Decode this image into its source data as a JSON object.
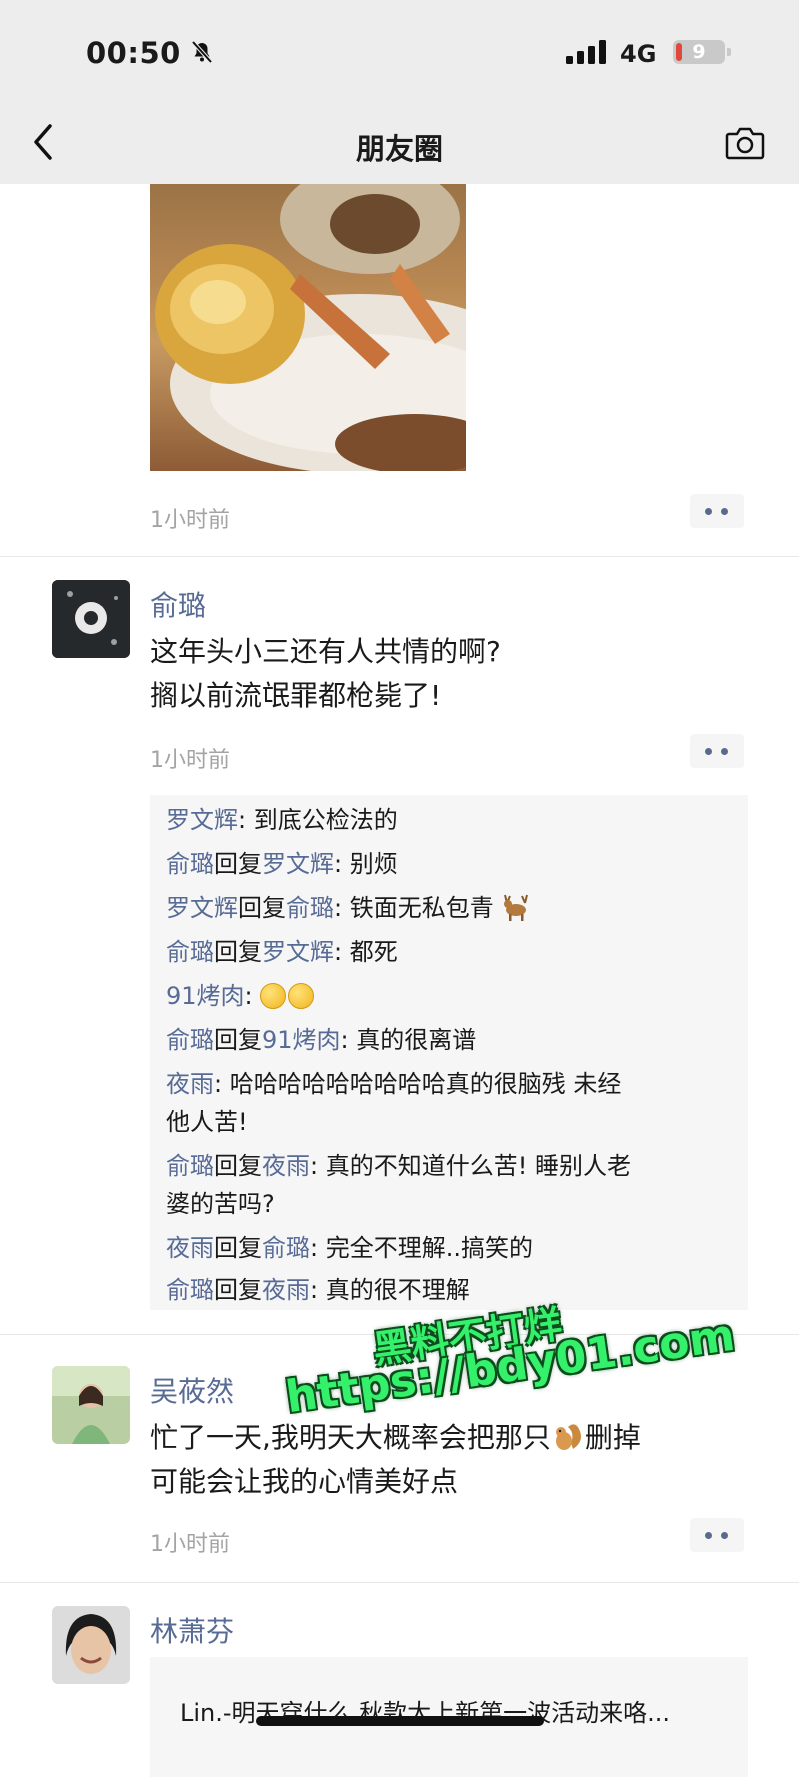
{
  "status_bar": {
    "time": "00:50",
    "network": "4G",
    "battery": "9"
  },
  "nav": {
    "title": "朋友圈"
  },
  "posts": [
    {
      "time": "1小时前"
    },
    {
      "author": "俞璐",
      "text_lines": [
        "这年头小三还有人共情的啊?",
        "搁以前流氓罪都枪毙了!"
      ],
      "time": "1小时前",
      "comments": [
        {
          "from": "罗文辉",
          "sep": ": ",
          "text": "到底公检法的"
        },
        {
          "from": "俞璐",
          "reply_word": "回复",
          "to": "罗文辉",
          "sep": ": ",
          "text": "别烦"
        },
        {
          "from": "罗文辉",
          "reply_word": "回复",
          "to": "俞璐",
          "sep": ": ",
          "text": "铁面无私包青",
          "emoji": "deer-emoji"
        },
        {
          "from": "俞璐",
          "reply_word": "回复",
          "to": "罗文辉",
          "sep": ": ",
          "text": "都死"
        },
        {
          "from": "91烤肉",
          "sep": ": ",
          "emoji": "laughing-crying-emoji"
        },
        {
          "from": "俞璐",
          "reply_word": "回复",
          "to": "91烤肉",
          "sep": ": ",
          "text": "真的很离谱"
        },
        {
          "from": "夜雨",
          "sep": ": ",
          "text_lines": [
            "哈哈哈哈哈哈哈哈哈真的很脑残 未经",
            "他人苦!"
          ]
        },
        {
          "from": "俞璐",
          "reply_word": "回复",
          "to": "夜雨",
          "sep": ": ",
          "text_lines": [
            "真的不知道什么苦! 睡别人老",
            "婆的苦吗?"
          ]
        },
        {
          "from": "夜雨",
          "reply_word": "回复",
          "to": "俞璐",
          "sep": ": ",
          "text": "完全不理解..搞笑的"
        },
        {
          "from": "俞璐",
          "reply_word": "回复",
          "to": "夜雨",
          "sep": ": ",
          "text": "真的很不理解"
        }
      ]
    },
    {
      "author": "吴莜然",
      "text_lines": [
        "忙了一天,我明天大概率会把那只",
        "删掉",
        "可能会让我的心情美好点"
      ],
      "time": "1小时前"
    },
    {
      "author": "林萧芬",
      "share_title": "Lin.-明天穿什么.秋款大上新第一波活动来咯..."
    }
  ],
  "watermark": {
    "line1": "黑料不打烊",
    "line2": "https://bdy01.com"
  },
  "colors": {
    "link": "#576b95",
    "bar_bg": "#ededed",
    "watermark": "#35f06a"
  }
}
